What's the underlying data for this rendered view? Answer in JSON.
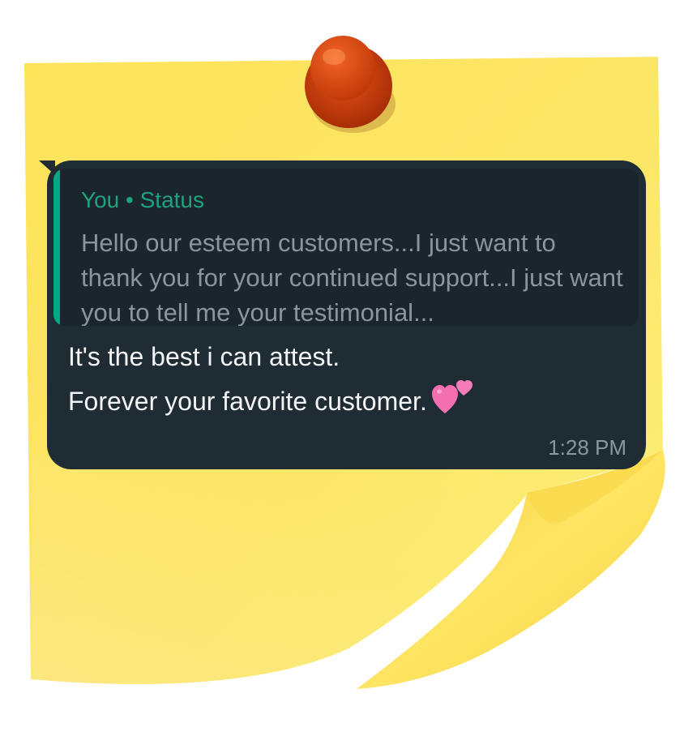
{
  "note": {
    "paper_color": "#fbe45c",
    "pin_color": "#d9440f"
  },
  "message": {
    "bubble_color": "#1f2c34",
    "quoted": {
      "author": "You • Status",
      "accent_color": "#02a884",
      "text": "Hello our esteem customers...I just want to thank you for your continued support...I just want you to tell me your testimonial..."
    },
    "reply": {
      "lines": [
        "It's the best i can attest.",
        "Forever your favorite customer."
      ],
      "emoji_icon": "two-hearts-icon"
    },
    "timestamp": "1:28 PM"
  }
}
